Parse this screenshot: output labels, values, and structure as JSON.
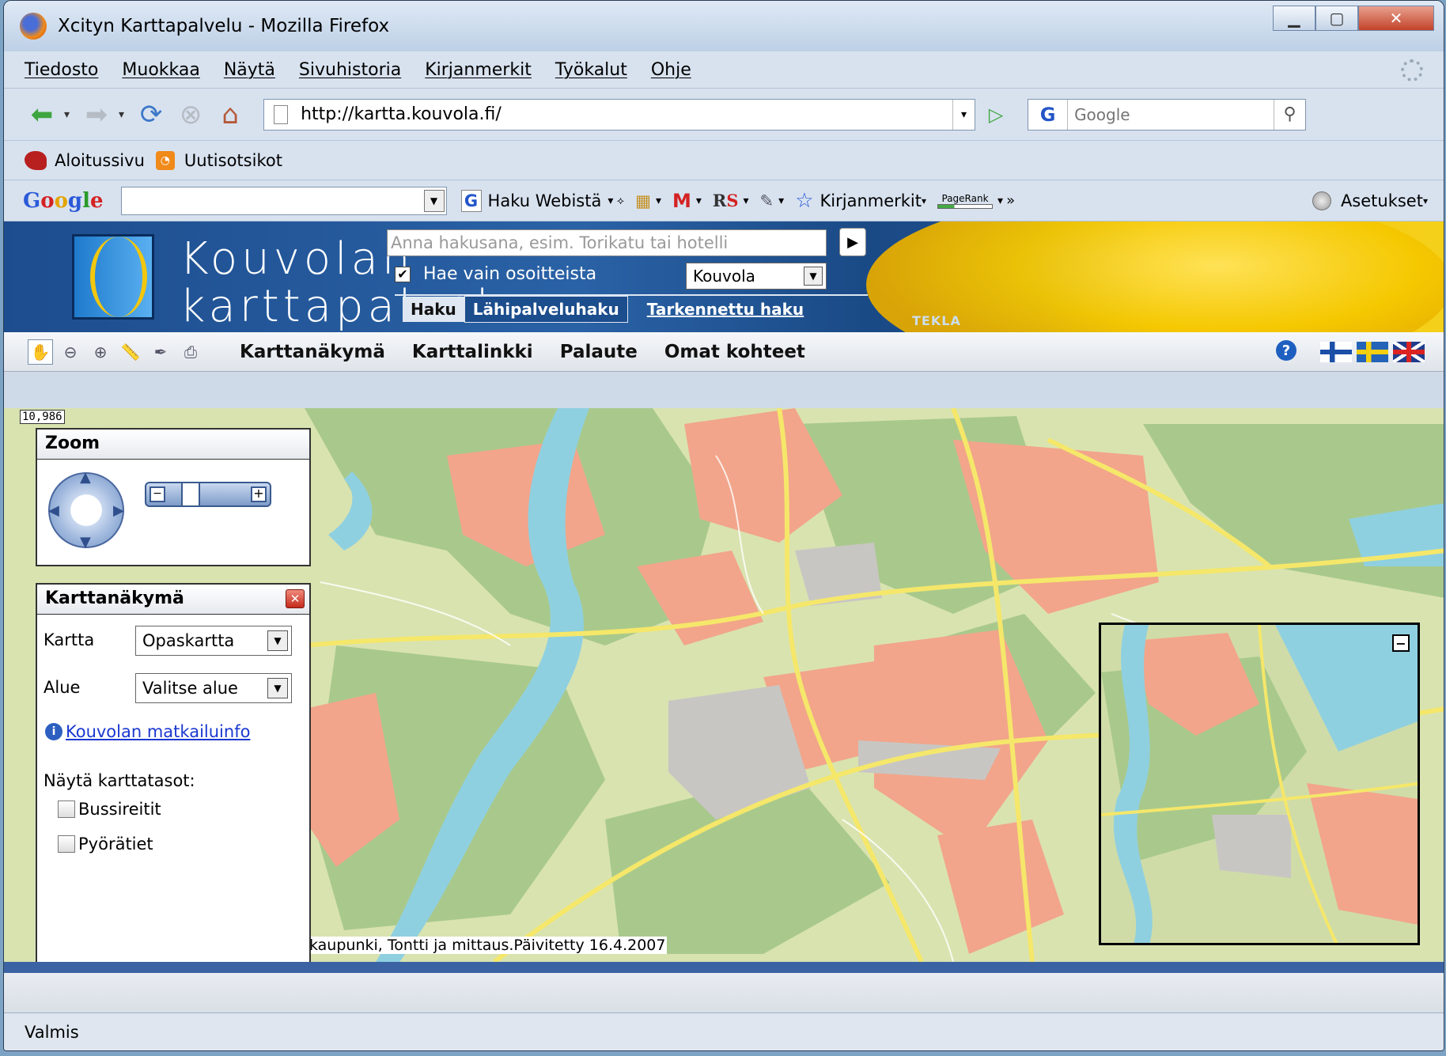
{
  "window": {
    "title": "Xcityn Karttapalvelu - Mozilla Firefox"
  },
  "menu": [
    "Tiedosto",
    "Muokkaa",
    "Näytä",
    "Sivuhistoria",
    "Kirjanmerkit",
    "Työkalut",
    "Ohje"
  ],
  "nav": {
    "url": "http://kartta.kouvola.fi/",
    "search_placeholder": "Google"
  },
  "bookmarks": [
    "Aloitussivu",
    "Uutisotsikot"
  ],
  "google_toolbar": {
    "search_label": "Haku Webistä",
    "bookmarks_label": "Kirjanmerkit",
    "pagerank_label": "PageRank",
    "settings_label": "Asetukset",
    "more": "»"
  },
  "site_header": {
    "title_line1": "Kouvolan",
    "title_line2": "karttapalvelu",
    "search_placeholder": "Anna hakusana, esim. Torikatu tai hotelli",
    "address_only_label": "Hae vain osoitteista",
    "address_only_checked": true,
    "city_select": "Kouvola",
    "tabs": [
      "Haku",
      "Lähipalveluhaku"
    ],
    "advanced_link": "Tarkennettu haku",
    "vendor": "TEKLA"
  },
  "app_toolbar": {
    "menu": [
      "Karttanäkymä",
      "Karttalinkki",
      "Palaute",
      "Omat kohteet"
    ]
  },
  "map": {
    "scale": "10,986",
    "copyright": "kaupunki, Tontti ja mittaus.Päivitetty 16.4.2007"
  },
  "zoom_panel": {
    "title": "Zoom",
    "zoom_level": 0.2
  },
  "view_panel": {
    "title": "Karttanäkymä",
    "kartta_label": "Kartta",
    "kartta_value": "Opaskartta",
    "alue_label": "Alue",
    "alue_value": "Valitse alue",
    "info_link": "Kouvolan matkailuinfo",
    "layers_title": "Näytä karttatasot:",
    "layers": [
      {
        "label": "Bussireitit",
        "checked": false
      },
      {
        "label": "Pyörätiet",
        "checked": false
      }
    ]
  },
  "status": "Valmis",
  "colors": {
    "header_blue": "#1d4d8e",
    "header_yellow": "#f2c70e",
    "map_green": "#a9c98c",
    "map_urban": "#f2a58a",
    "map_water": "#8fd0e0",
    "map_road": "#f5e76a",
    "link_blue": "#1a38d0"
  }
}
